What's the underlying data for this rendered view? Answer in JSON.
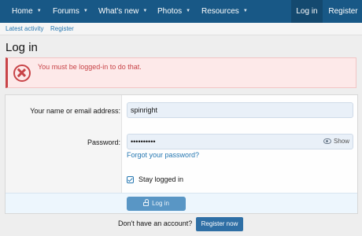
{
  "nav": {
    "items": [
      {
        "label": "Home"
      },
      {
        "label": "Forums"
      },
      {
        "label": "What's new"
      },
      {
        "label": "Photos"
      },
      {
        "label": "Resources"
      }
    ],
    "login": "Log in",
    "register": "Register"
  },
  "subnav": {
    "latest_activity": "Latest activity",
    "register": "Register"
  },
  "page": {
    "title": "Log in",
    "error": "You must be logged-in to do that."
  },
  "form": {
    "username_label": "Your name or email address:",
    "username_value": "spinright",
    "password_label": "Password:",
    "password_value": "••••••••••",
    "show_label": "Show",
    "forgot_link": "Forgot your password?",
    "stay_logged_in": "Stay logged in",
    "stay_checked": true,
    "submit_label": "Log in"
  },
  "signup": {
    "text": "Don't have an account?",
    "button": "Register now"
  },
  "colors": {
    "nav_bg": "#185886",
    "error": "#c84448",
    "link": "#2577b1",
    "primary_button": "#5996c5"
  }
}
